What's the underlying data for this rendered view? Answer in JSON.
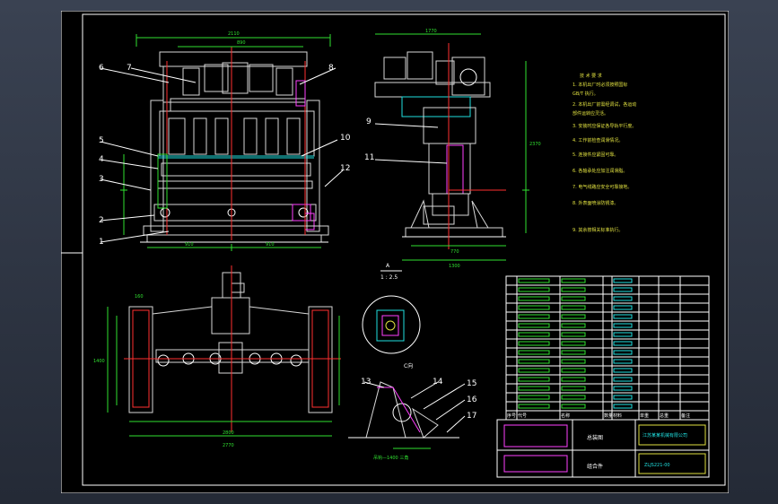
{
  "callouts_front": [
    "6",
    "7",
    "8",
    "5",
    "4",
    "3",
    "2",
    "1",
    "10",
    "12"
  ],
  "callouts_side": [
    "9",
    "11"
  ],
  "callouts_detail": [
    "13",
    "14",
    "15",
    "16",
    "17"
  ],
  "dims_front": {
    "top_overall": "2110",
    "top_inner": "890",
    "bottom_left": "910",
    "bottom_right": "910"
  },
  "dims_side": {
    "top": "1770",
    "bottom_1": "770",
    "bottom_2": "1300",
    "height": "2370"
  },
  "dims_plan": {
    "bottom_1": "2800",
    "bottom_2": "2770",
    "left": "1400",
    "top_left": "160"
  },
  "view_label_scale": "1 : 2.5",
  "view_label_a": "A",
  "view_label_c": "C向",
  "weld_note": "吊钩—1400 三角",
  "notes_title": "技 术 要 求",
  "notes": [
    "1. 本机出厂时必须按照国标",
    "   GB/T 执行。",
    "2. 本机出厂前需经调试，各运动",
    "   部件运转应灵活。",
    "3. 安装时应保证各导轨平行度。",
    "4. 工作前检查润滑情况。",
    "5. 连接件应紧固可靠。",
    "6. 各轴承处应加注润滑脂。",
    "7. 电气线路应安全可靠接地。",
    "8. 外表面喷涂防锈漆。",
    "9. 其余按相关标准执行。"
  ],
  "bom_header": [
    "序号",
    "代号",
    "名称",
    "数量",
    "材料",
    "单重",
    "总重",
    "备注"
  ],
  "title_block": {
    "drawing_name": "总装图",
    "company": "江苏某某机械有限公司",
    "drawing_no": "ZLJS221-00",
    "assembly_label": "组合件"
  }
}
